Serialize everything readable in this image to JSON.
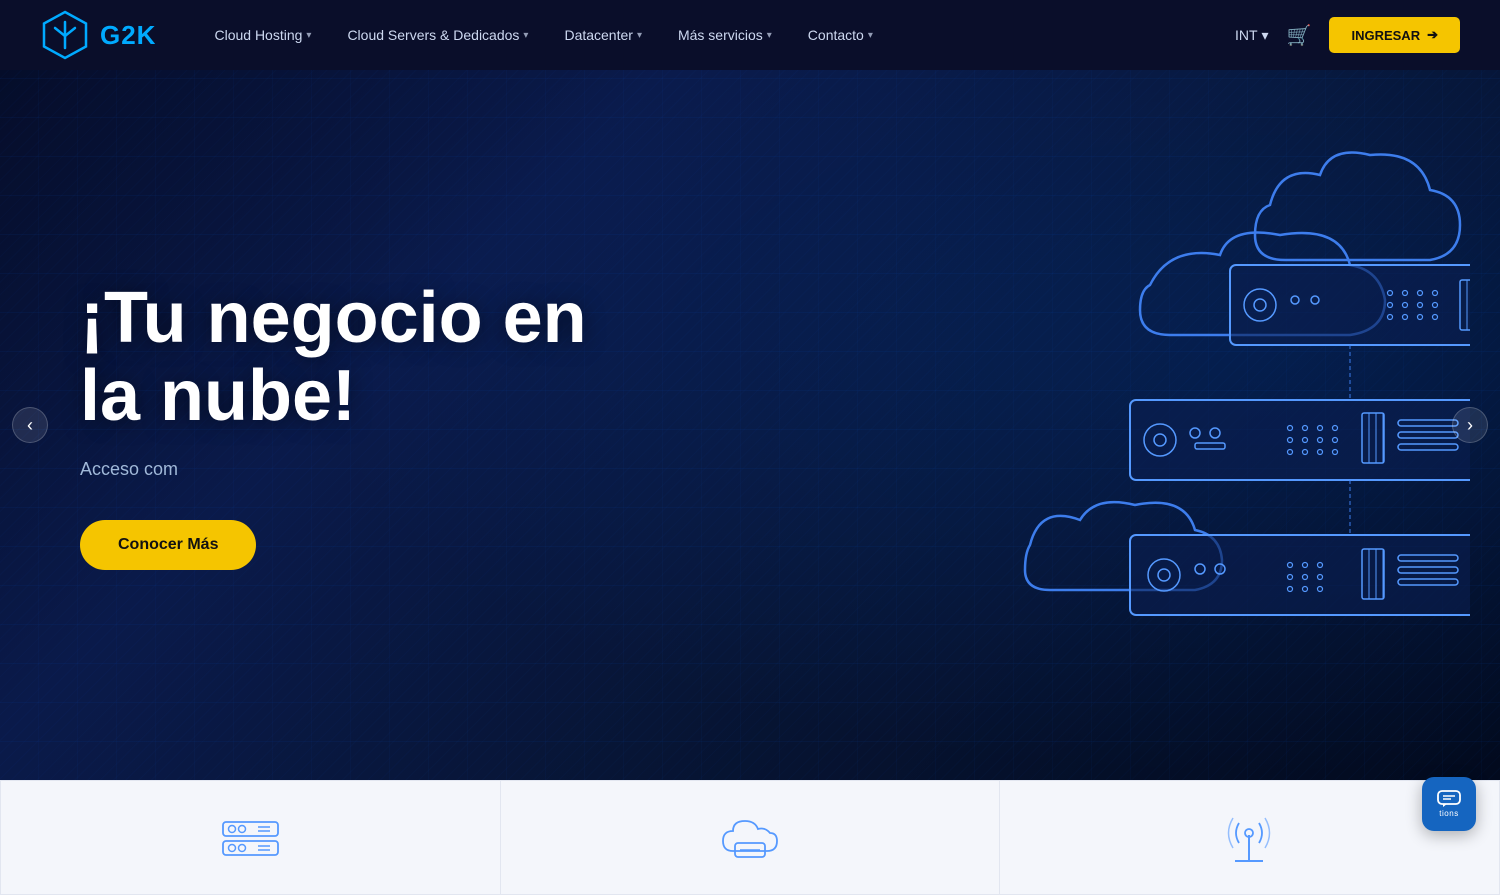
{
  "brand": {
    "logo_text": "G2K",
    "logo_alt": "G2K Logo"
  },
  "nav": {
    "links": [
      {
        "label": "Cloud Hosting",
        "has_dropdown": true
      },
      {
        "label": "Cloud Servers & Dedicados",
        "has_dropdown": true
      },
      {
        "label": "Datacenter",
        "has_dropdown": true
      },
      {
        "label": "Más servicios",
        "has_dropdown": true
      },
      {
        "label": "Contacto",
        "has_dropdown": true
      }
    ],
    "lang": "INT",
    "ingresar_label": "INGRESAR"
  },
  "hero": {
    "title": "¡Tu negocio en la nube!",
    "subtitle": "Acceso com",
    "cta_label": "Conocer Más"
  },
  "cards": [
    {
      "icon": "server-icon"
    },
    {
      "icon": "cloud-icon"
    },
    {
      "icon": "antenna-icon"
    }
  ],
  "chat": {
    "label": "tions"
  },
  "colors": {
    "accent": "#f5c500",
    "primary": "#0a0e2a",
    "blue": "#00aaff",
    "cta_bg": "#f5c500"
  }
}
